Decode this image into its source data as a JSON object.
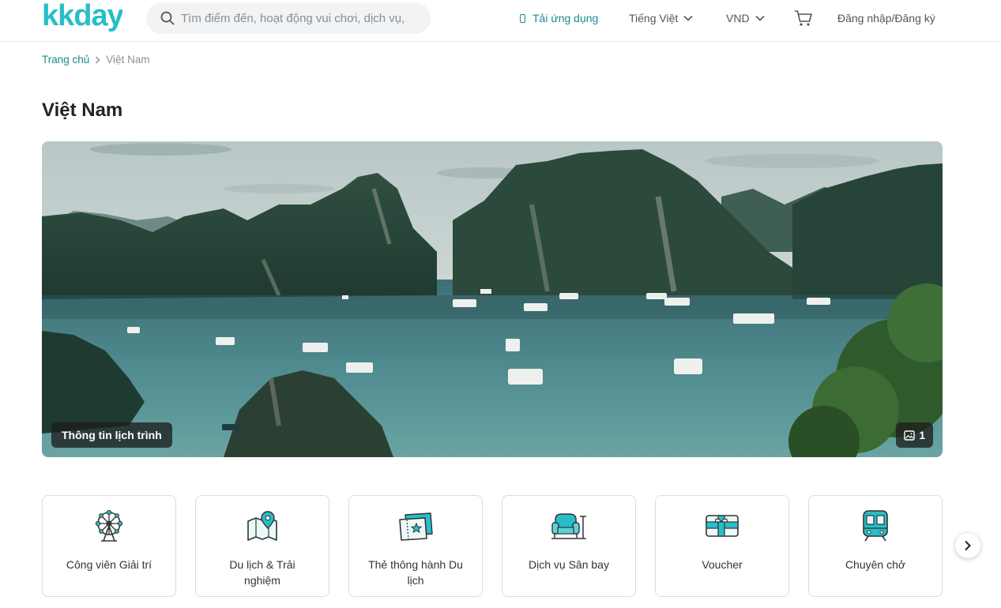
{
  "brand": {
    "name": "kkday",
    "color": "#26bec9"
  },
  "search": {
    "placeholder": "Tìm điểm đến, hoạt động vui chơi, dịch vụ,",
    "icon": "search-icon"
  },
  "nav": {
    "app_label": "Tải ứng dụng",
    "language_label": "Tiếng Việt",
    "currency_label": "VND",
    "cart_icon": "cart-icon",
    "login_label": "Đăng nhập/Đăng ký"
  },
  "breadcrumb": {
    "home": "Trang chủ",
    "current": "Việt Nam"
  },
  "page": {
    "title": "Việt Nam"
  },
  "hero": {
    "tag_label": "Thông tin lịch trình",
    "photo_count": "1",
    "photo_icon": "image-icon"
  },
  "categories": [
    {
      "label": "Công viên Giải trí",
      "icon": "ferris-wheel-icon"
    },
    {
      "label": "Du lịch & Trải nghiệm",
      "icon": "map-pin-icon"
    },
    {
      "label": "Thẻ thông hành Du lịch",
      "icon": "ticket-icon"
    },
    {
      "label": "Dịch vụ Sân bay",
      "icon": "lounge-chair-icon"
    },
    {
      "label": "Voucher",
      "icon": "gift-card-icon"
    },
    {
      "label": "Chuyên chở",
      "icon": "train-icon"
    }
  ],
  "colors": {
    "accent": "#1b8a8f",
    "icon_teal": "#26bec9",
    "border": "#d9dcdf"
  }
}
